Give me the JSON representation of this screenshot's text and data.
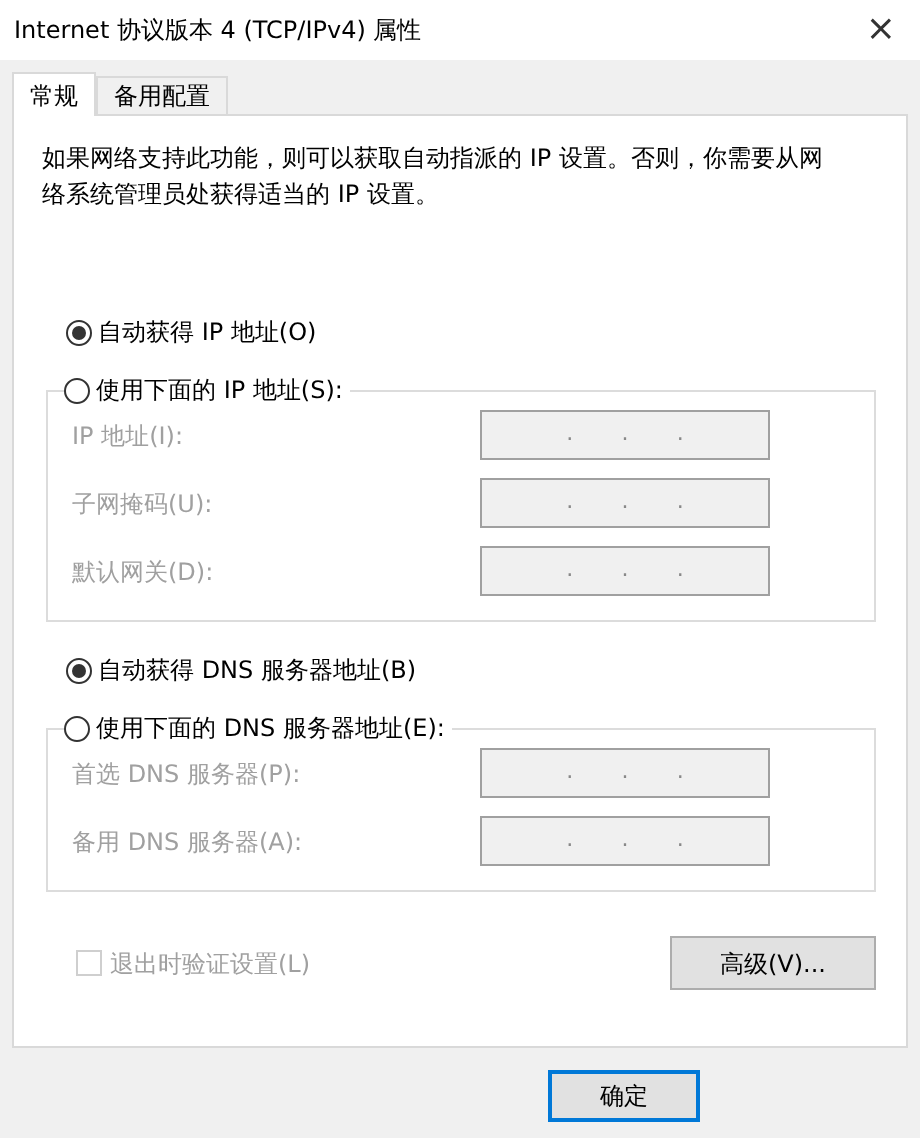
{
  "window": {
    "title": "Internet 协议版本 4 (TCP/IPv4) 属性",
    "close": "×"
  },
  "tabs": [
    {
      "label": "常规",
      "selected": true
    },
    {
      "label": "备用配置",
      "selected": false
    }
  ],
  "description": "如果网络支持此功能，则可以获取自动指派的 IP 设置。否则，你需要从网络系统管理员处获得适当的 IP 设置。",
  "sections": [
    {
      "auto_option": {
        "label": "自动获得 IP 地址(O)",
        "selected": true
      },
      "manual_option": {
        "label": "使用下面的 IP 地址(S):",
        "selected": false
      },
      "fields": [
        {
          "label": "IP 地址(I):",
          "disabled": true,
          "separators": [
            ".",
            ".",
            "."
          ]
        },
        {
          "label": "子网掩码(U):",
          "disabled": true,
          "separators": [
            ".",
            ".",
            "."
          ]
        },
        {
          "label": "默认网关(D):",
          "disabled": true,
          "separators": [
            ".",
            ".",
            "."
          ]
        }
      ]
    },
    {
      "auto_option": {
        "label": "自动获得 DNS 服务器地址(B)",
        "selected": true
      },
      "manual_option": {
        "label": "使用下面的 DNS 服务器地址(E):",
        "selected": false
      },
      "fields": [
        {
          "label": "首选 DNS 服务器(P):",
          "disabled": true,
          "separators": [
            ".",
            ".",
            "."
          ]
        },
        {
          "label": "备用 DNS 服务器(A):",
          "disabled": true,
          "separators": [
            ".",
            ".",
            "."
          ]
        }
      ]
    }
  ],
  "validate_checkbox": {
    "label": "退出时验证设置(L)",
    "checked": false,
    "disabled": true
  },
  "advanced_button": "高级(V)...",
  "ok_button": "确定"
}
